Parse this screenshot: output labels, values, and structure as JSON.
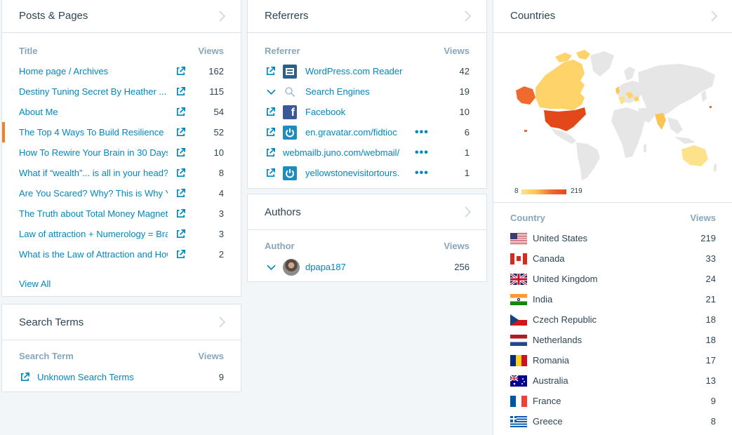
{
  "posts": {
    "title": "Posts & Pages",
    "col_title": "Title",
    "col_views": "Views",
    "rows": [
      {
        "label": "Home page / Archives",
        "views": "162"
      },
      {
        "label": "Destiny Tuning Secret By Heather ...",
        "views": "115"
      },
      {
        "label": "About Me",
        "views": "54"
      },
      {
        "label": "The Top 4 Ways To Build Resilience",
        "views": "52"
      },
      {
        "label": "How To Rewire Your Brain in 30 Days",
        "views": "10"
      },
      {
        "label": "What if “wealth”... is all in your head?",
        "views": "8"
      },
      {
        "label": "Are You Scared? Why? This is Why You",
        "views": "4"
      },
      {
        "label": "The Truth about Total Money Magnetism",
        "views": "3"
      },
      {
        "label": "Law of attraction + Numerology = Brain",
        "views": "3"
      },
      {
        "label": "What is the Law of Attraction and How",
        "views": "2"
      }
    ],
    "view_all": "View All"
  },
  "search_terms": {
    "title": "Search Terms",
    "col_term": "Search Term",
    "col_views": "Views",
    "rows": [
      {
        "label": "Unknown Search Terms",
        "views": "9"
      }
    ]
  },
  "referrers": {
    "title": "Referrers",
    "col_ref": "Referrer",
    "col_views": "Views",
    "rows": [
      {
        "label": "WordPress.com Reader",
        "views": "42",
        "icon": "wordpress-reader-icon"
      },
      {
        "label": "Search Engines",
        "views": "19",
        "icon": "search-icon"
      },
      {
        "label": "Facebook",
        "views": "10",
        "icon": "facebook-icon"
      },
      {
        "label": "en.gravatar.com/fidtioc",
        "views": "6",
        "icon": "gravatar-icon"
      },
      {
        "label": "webmailb.juno.com/webmail/",
        "views": "1",
        "icon": ""
      },
      {
        "label": "yellowstonevisitortours.",
        "views": "1",
        "icon": "gravatar-icon"
      }
    ],
    "more": "•••"
  },
  "authors": {
    "title": "Authors",
    "col_author": "Author",
    "col_views": "Views",
    "rows": [
      {
        "label": "dpapa187",
        "views": "256"
      }
    ]
  },
  "countries": {
    "title": "Countries",
    "legend_min": "8",
    "legend_max": "219",
    "col_country": "Country",
    "col_views": "Views",
    "rows": [
      {
        "label": "United States",
        "views": "219",
        "flag": "us"
      },
      {
        "label": "Canada",
        "views": "33",
        "flag": "ca"
      },
      {
        "label": "United Kingdom",
        "views": "24",
        "flag": "gb"
      },
      {
        "label": "India",
        "views": "21",
        "flag": "in"
      },
      {
        "label": "Czech Republic",
        "views": "18",
        "flag": "cz"
      },
      {
        "label": "Netherlands",
        "views": "18",
        "flag": "nl"
      },
      {
        "label": "Romania",
        "views": "17",
        "flag": "ro"
      },
      {
        "label": "Australia",
        "views": "13",
        "flag": "au"
      },
      {
        "label": "France",
        "views": "9",
        "flag": "fr"
      },
      {
        "label": "Greece",
        "views": "8",
        "flag": "gr"
      }
    ]
  },
  "colors": {
    "link": "#0087be",
    "accent": "#f0821e",
    "muted": "#87a6bc",
    "border": "#dce4ea"
  }
}
